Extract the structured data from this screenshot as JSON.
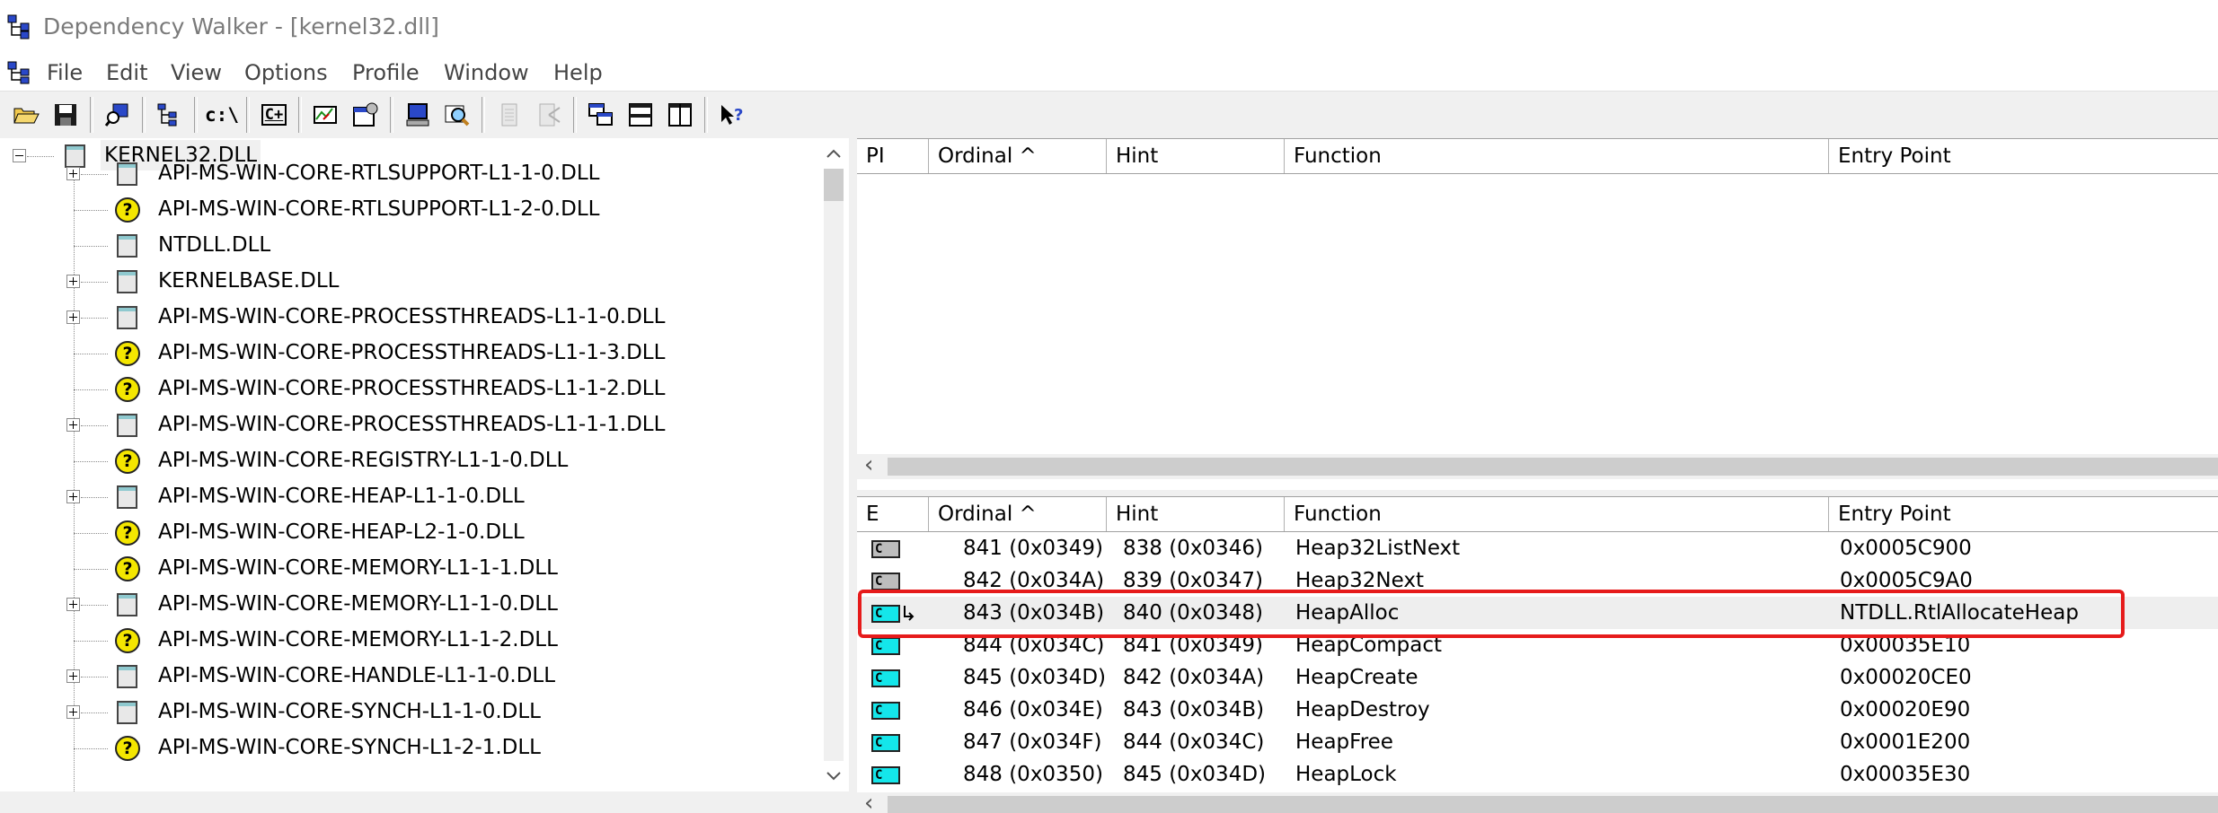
{
  "window": {
    "title": "Dependency Walker - [kernel32.dll]"
  },
  "menu": [
    "File",
    "Edit",
    "View",
    "Options",
    "Profile",
    "Window",
    "Help"
  ],
  "toolbar": {
    "buttons": [
      "open-icon",
      "save-icon",
      "find-icon",
      "full-paths-icon",
      "undecorate-icon",
      "cpp-icon",
      "profile-icon",
      "properties-icon",
      "system-info-icon",
      "search-icon",
      "import-icon",
      "export-icon",
      "cascade-icon",
      "tile-horizontal-icon",
      "tile-vertical-icon",
      "help-icon"
    ]
  },
  "tree": {
    "root": "KERNEL32.DLL",
    "items": [
      {
        "label": "API-MS-WIN-CORE-RTLSUPPORT-L1-1-0.DLL",
        "icon": "module",
        "expandable": true
      },
      {
        "label": "API-MS-WIN-CORE-RTLSUPPORT-L1-2-0.DLL",
        "icon": "missing",
        "expandable": false
      },
      {
        "label": "NTDLL.DLL",
        "icon": "module",
        "expandable": false
      },
      {
        "label": "KERNELBASE.DLL",
        "icon": "module",
        "expandable": true
      },
      {
        "label": "API-MS-WIN-CORE-PROCESSTHREADS-L1-1-0.DLL",
        "icon": "module",
        "expandable": true
      },
      {
        "label": "API-MS-WIN-CORE-PROCESSTHREADS-L1-1-3.DLL",
        "icon": "missing",
        "expandable": false
      },
      {
        "label": "API-MS-WIN-CORE-PROCESSTHREADS-L1-1-2.DLL",
        "icon": "missing",
        "expandable": false
      },
      {
        "label": "API-MS-WIN-CORE-PROCESSTHREADS-L1-1-1.DLL",
        "icon": "module",
        "expandable": true
      },
      {
        "label": "API-MS-WIN-CORE-REGISTRY-L1-1-0.DLL",
        "icon": "missing",
        "expandable": false
      },
      {
        "label": "API-MS-WIN-CORE-HEAP-L1-1-0.DLL",
        "icon": "module",
        "expandable": true
      },
      {
        "label": "API-MS-WIN-CORE-HEAP-L2-1-0.DLL",
        "icon": "missing",
        "expandable": false
      },
      {
        "label": "API-MS-WIN-CORE-MEMORY-L1-1-1.DLL",
        "icon": "missing",
        "expandable": false
      },
      {
        "label": "API-MS-WIN-CORE-MEMORY-L1-1-0.DLL",
        "icon": "module",
        "expandable": true
      },
      {
        "label": "API-MS-WIN-CORE-MEMORY-L1-1-2.DLL",
        "icon": "missing",
        "expandable": false
      },
      {
        "label": "API-MS-WIN-CORE-HANDLE-L1-1-0.DLL",
        "icon": "module",
        "expandable": true
      },
      {
        "label": "API-MS-WIN-CORE-SYNCH-L1-1-0.DLL",
        "icon": "module",
        "expandable": true
      },
      {
        "label": "API-MS-WIN-CORE-SYNCH-L1-2-1.DLL",
        "icon": "missing",
        "expandable": false
      }
    ]
  },
  "imports": {
    "columns": [
      "PI",
      "Ordinal ^",
      "Hint",
      "Function",
      "Entry Point"
    ]
  },
  "exports": {
    "columns": [
      "E",
      "Ordinal ^",
      "Hint",
      "Function",
      "Entry Point"
    ],
    "rows": [
      {
        "ordinal": "841 (0x0349)",
        "hint": "838 (0x0346)",
        "function": "Heap32ListNext",
        "entry": "0x0005C900",
        "icon": "gray",
        "forwarded": false
      },
      {
        "ordinal": "842 (0x034A)",
        "hint": "839 (0x0347)",
        "function": "Heap32Next",
        "entry": "0x0005C9A0",
        "icon": "gray",
        "forwarded": false
      },
      {
        "ordinal": "843 (0x034B)",
        "hint": "840 (0x0348)",
        "function": "HeapAlloc",
        "entry": "NTDLL.RtlAllocateHeap",
        "icon": "cyan",
        "forwarded": true
      },
      {
        "ordinal": "844 (0x034C)",
        "hint": "841 (0x0349)",
        "function": "HeapCompact",
        "entry": "0x00035E10",
        "icon": "cyan",
        "forwarded": false
      },
      {
        "ordinal": "845 (0x034D)",
        "hint": "842 (0x034A)",
        "function": "HeapCreate",
        "entry": "0x00020CE0",
        "icon": "cyan",
        "forwarded": false
      },
      {
        "ordinal": "846 (0x034E)",
        "hint": "843 (0x034B)",
        "function": "HeapDestroy",
        "entry": "0x00020E90",
        "icon": "cyan",
        "forwarded": false
      },
      {
        "ordinal": "847 (0x034F)",
        "hint": "844 (0x034C)",
        "function": "HeapFree",
        "entry": "0x0001E200",
        "icon": "cyan",
        "forwarded": false
      },
      {
        "ordinal": "848 (0x0350)",
        "hint": "845 (0x034D)",
        "function": "HeapLock",
        "entry": "0x00035E30",
        "icon": "cyan",
        "forwarded": false
      }
    ],
    "highlighted_function": "HeapAlloc"
  },
  "colors": {
    "highlight_border": "#e61b1b",
    "export_icon_cyan": "#14e6ea",
    "missing_icon_yellow": "#f4e600"
  }
}
